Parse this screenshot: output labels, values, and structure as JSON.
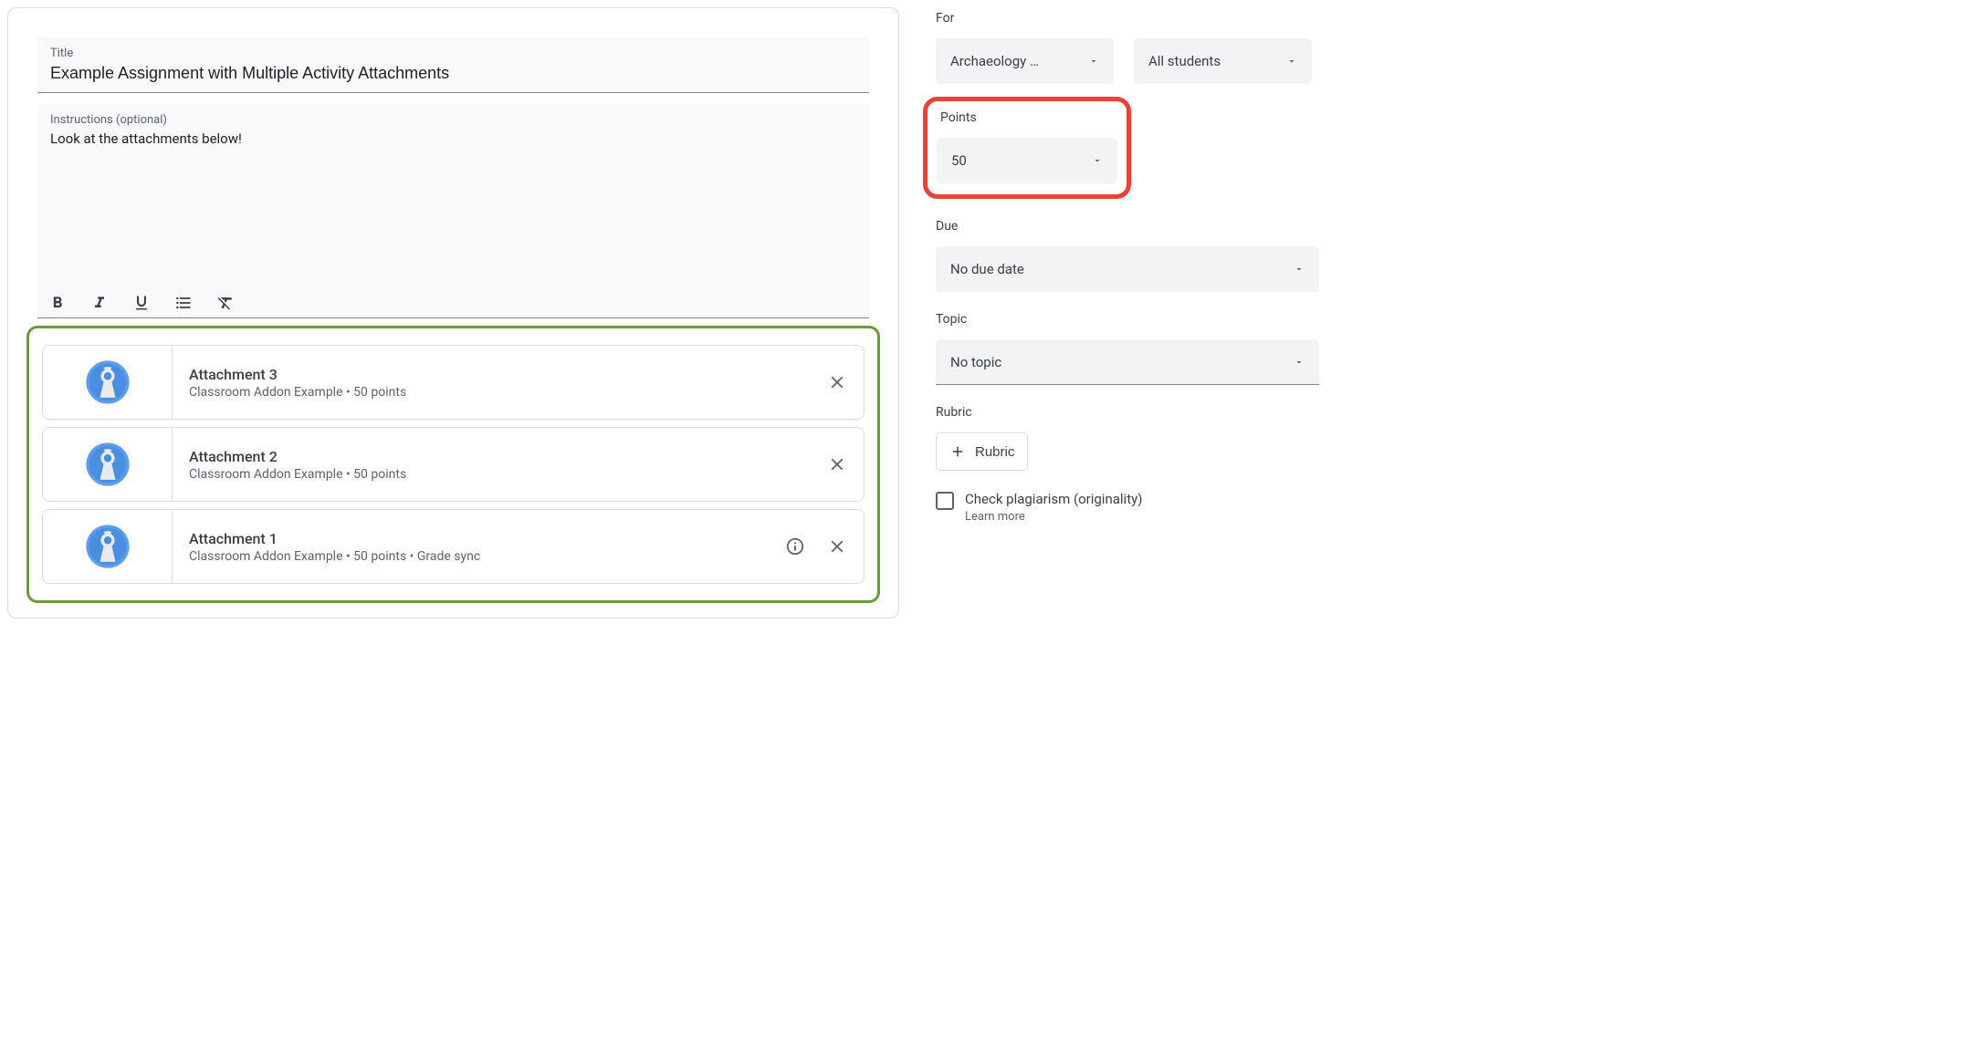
{
  "title_field": {
    "label": "Title",
    "value": "Example Assignment with Multiple Activity Attachments"
  },
  "instructions_field": {
    "label": "Instructions (optional)",
    "value": "Look at the attachments below!"
  },
  "attachments": [
    {
      "title": "Attachment 3",
      "subtitle": "Classroom Addon Example • 50 points",
      "has_info": false
    },
    {
      "title": "Attachment 2",
      "subtitle": "Classroom Addon Example • 50 points",
      "has_info": false
    },
    {
      "title": "Attachment 1",
      "subtitle": "Classroom Addon Example • 50 points • Grade sync",
      "has_info": true
    }
  ],
  "sidebar": {
    "for_label": "For",
    "class_value": "Archaeology …",
    "students_value": "All students",
    "points_label": "Points",
    "points_value": "50",
    "due_label": "Due",
    "due_value": "No due date",
    "topic_label": "Topic",
    "topic_value": "No topic",
    "rubric_label": "Rubric",
    "rubric_button": "Rubric",
    "plagiarism_label": "Check plagiarism (originality)",
    "learn_more": "Learn more"
  }
}
